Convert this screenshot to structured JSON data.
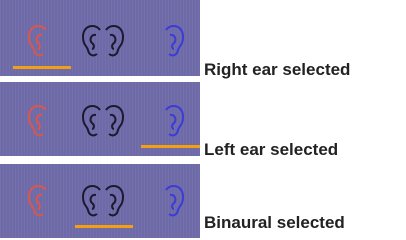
{
  "rows": [
    {
      "caption": "Right ear selected",
      "selected": "right"
    },
    {
      "caption": "Left ear selected",
      "selected": "left"
    },
    {
      "caption": "Binaural selected",
      "selected": "binaural"
    }
  ],
  "icons": {
    "right": "right-ear-icon",
    "binaural": "binaural-ears-icon",
    "left": "left-ear-icon"
  },
  "colors": {
    "panel": "#6e6aa8",
    "right_ear": "#d9574e",
    "binaural": "#1a1a2e",
    "left_ear": "#3c3ad8",
    "indicator": "#f2a012"
  }
}
